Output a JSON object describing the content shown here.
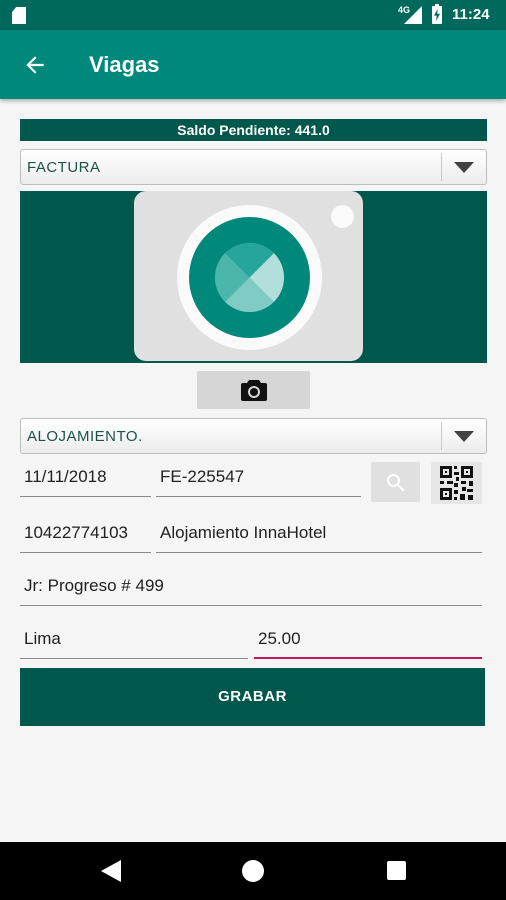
{
  "status_bar": {
    "time": "11:24",
    "network": "4G",
    "icons": [
      "sd-card-icon",
      "signal-icon",
      "battery-charging-icon"
    ]
  },
  "app_bar": {
    "title": "Viagas",
    "back_icon": "arrow-back-icon"
  },
  "saldo": "Saldo Pendiente: 441.0",
  "document_type": {
    "selected": "FACTURA"
  },
  "photo": {
    "placeholder_icon": "camera-placeholder-icon",
    "capture_icon": "camera-icon"
  },
  "expense_type": {
    "selected": "ALOJAMIENTO."
  },
  "form": {
    "date": "11/11/2018",
    "document_number": "FE-225547",
    "ruc": "10422774103",
    "business_name": "Alojamiento InnaHotel",
    "address": "Jr: Progreso # 499",
    "city": "Lima",
    "amount": "25.00"
  },
  "buttons": {
    "search_icon": "search-icon",
    "qr_icon": "qr-code-icon",
    "save_label": "GRABAR"
  },
  "colors": {
    "primary": "#00897b",
    "primary_dark": "#00574b",
    "accent": "#c2185b"
  }
}
